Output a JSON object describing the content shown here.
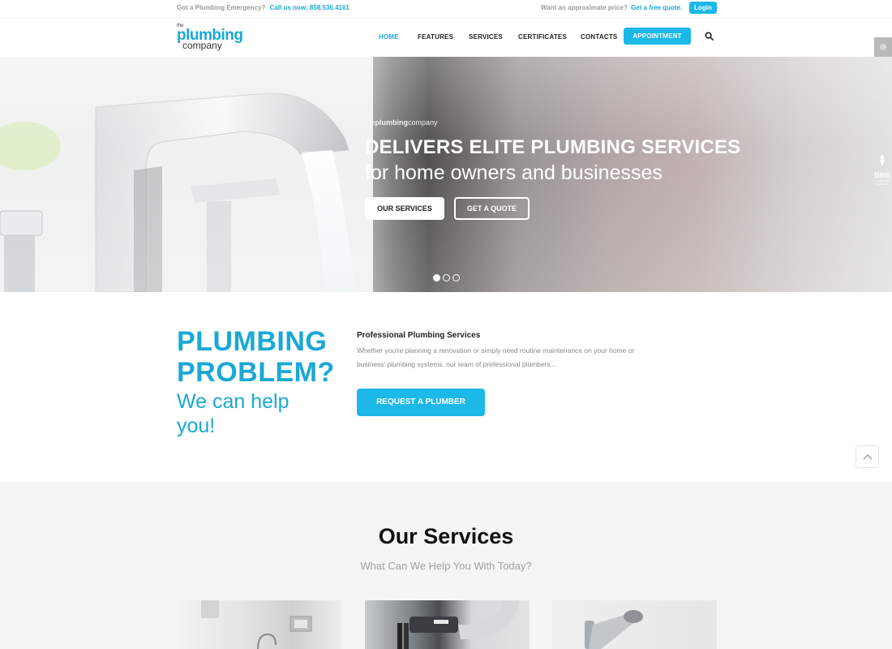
{
  "topbar": {
    "emergency_text": "Got a Plumbing Emergency?",
    "call_text": "Call us now: 858.536.4161",
    "price_text": "Want an approximate price?",
    "quote_link": "Get a free quote.",
    "login_label": "Login"
  },
  "logo": {
    "the": "the",
    "plumbing": "plumbing",
    "company": "company"
  },
  "nav": {
    "items": [
      {
        "label": "HOME",
        "active": true
      },
      {
        "label": "FEATURES"
      },
      {
        "label": "SERVICES"
      },
      {
        "label": "CERTIFICATES"
      },
      {
        "label": "CONTACTS"
      }
    ],
    "appointment_label": "APPOINTMENT",
    "search_icon": "search-icon",
    "settings_icon": "gear-icon"
  },
  "hero": {
    "brand_the": "the",
    "brand_plumbing": "plumbing",
    "brand_company": "company",
    "title": "DELIVERS ELITE PLUMBING SERVICES",
    "subtitle": "for home owners and businesses",
    "primary_button": "OUR SERVICES",
    "secondary_button": "GET A QUOTE",
    "slides": 3,
    "active_slide": 1,
    "badge_title": "BBB",
    "badge_sub1": "ACCREDITED",
    "badge_sub2": "BUSINESS"
  },
  "problem": {
    "heading": "PLUMBING PROBLEM?",
    "subheading": "We can help you!",
    "title": "Professional Plumbing Services",
    "text": "Whether you're planning a renovation or simply need routine maintenance on your home or business' plumbing systems, our team of prefessional plumbers...",
    "button": "REQUEST A PLUMBER",
    "scroll_top_icon": "chevron-up-icon"
  },
  "services": {
    "title": "Our Services",
    "subtitle": "What Can We Help You With Today?",
    "cards": [
      {
        "image": "kitchen-image"
      },
      {
        "image": "industrial-pipes-image"
      },
      {
        "image": "chrome-faucet-image"
      }
    ]
  },
  "colors": {
    "accent": "#1cb8e8",
    "accent_text": "#1aa8d6"
  }
}
